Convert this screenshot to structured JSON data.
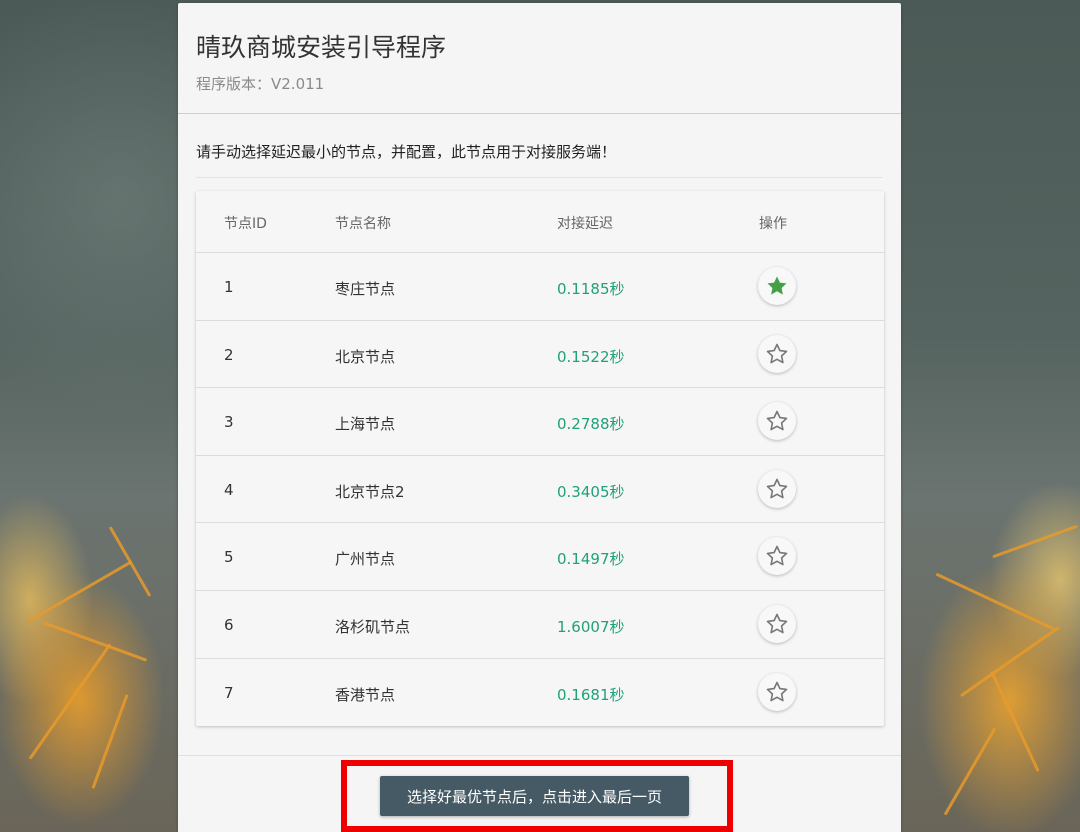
{
  "installer": {
    "title": "晴玖商城安装引导程序",
    "version_label": "程序版本：V2.011",
    "notice": "请手动选择延迟最小的节点，并配置，此节点用于对接服务端！"
  },
  "table": {
    "headers": {
      "id": "节点ID",
      "name": "节点名称",
      "latency": "对接延迟",
      "action": "操作"
    },
    "rows": [
      {
        "id": "1",
        "name": "枣庄节点",
        "latency": "0.1185秒",
        "selected": true
      },
      {
        "id": "2",
        "name": "北京节点",
        "latency": "0.1522秒",
        "selected": false
      },
      {
        "id": "3",
        "name": "上海节点",
        "latency": "0.2788秒",
        "selected": false
      },
      {
        "id": "4",
        "name": "北京节点2",
        "latency": "0.3405秒",
        "selected": false
      },
      {
        "id": "5",
        "name": "广州节点",
        "latency": "0.1497秒",
        "selected": false
      },
      {
        "id": "6",
        "name": "洛杉矶节点",
        "latency": "1.6007秒",
        "selected": false
      },
      {
        "id": "7",
        "name": "香港节点",
        "latency": "0.1681秒",
        "selected": false
      }
    ],
    "icons": {
      "selected": "star-filled-icon",
      "unselected": "star-outline-icon"
    }
  },
  "footer": {
    "next_label": "选择好最优节点后，点击进入最后一页"
  },
  "colors": {
    "latency": "#21a07a",
    "star_selected": "#43a047",
    "star_unselected": "#777777",
    "button_bg": "#455a64",
    "highlight_border": "#ee0000"
  }
}
